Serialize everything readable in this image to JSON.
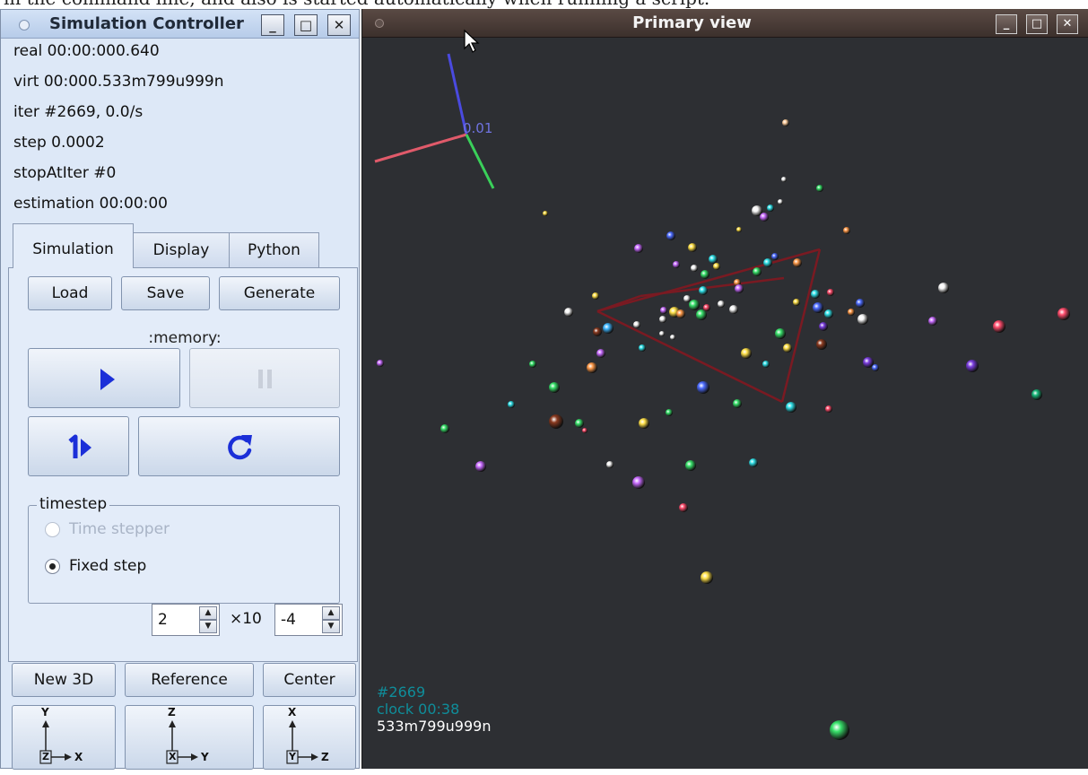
{
  "caption": "in the command line, and also is started automatically when running a script.",
  "controller": {
    "title": "Simulation Controller",
    "window_buttons": {
      "minimize": "_",
      "maximize": "□",
      "close": "✕"
    },
    "status": {
      "real": "real 00:00:000.640",
      "virt": "virt 00:000.533m799u999n",
      "iter": "iter #2669, 0.0/s",
      "step": "step 0.0002",
      "stop": "stopAtIter #0",
      "estimation": "estimation 00:00:00"
    },
    "tabs": [
      "Simulation",
      "Display",
      "Python"
    ],
    "buttons": {
      "load": "Load",
      "save": "Save",
      "generate": "Generate"
    },
    "memory_label": ":memory:",
    "timestep": {
      "title": "timestep",
      "options": [
        "Time stepper",
        "Fixed step"
      ],
      "selected": "Fixed step",
      "mantissa": "2",
      "times": "×10",
      "exponent": "-4"
    },
    "bottom_buttons": {
      "new3d": "New 3D",
      "reference": "Reference",
      "center": "Center"
    },
    "axis_buttons": [
      {
        "up": "Y",
        "box": "Z",
        "right": "X"
      },
      {
        "up": "Z",
        "box": "X",
        "right": "Y"
      },
      {
        "up": "X",
        "box": "Y",
        "right": "Z"
      }
    ]
  },
  "view": {
    "title": "Primary view",
    "window_buttons": {
      "minimize": "_",
      "maximize": "□",
      "close": "✕"
    },
    "axis_label": "0.01",
    "overlay": {
      "iter": "#2669",
      "clock": "clock 00:38",
      "virt": "533m799u999n"
    },
    "colors": {
      "iter": "#0f8d9a",
      "clock": "#0f8d9a",
      "virt": "#ffffff",
      "box": "#7a1a22"
    }
  }
}
